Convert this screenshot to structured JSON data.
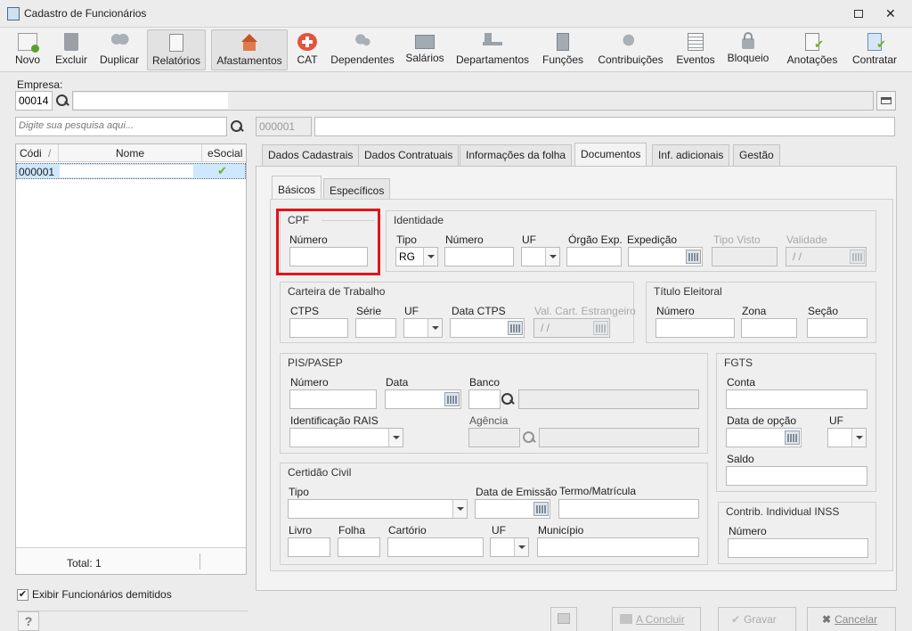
{
  "window": {
    "title": "Cadastro de Funcionários"
  },
  "toolbar": {
    "items": [
      "Novo",
      "Excluir",
      "Duplicar",
      "Relatórios",
      "Afastamentos",
      "CAT",
      "Dependentes",
      "Salários",
      "Departamentos",
      "Funções",
      "Contribuições",
      "Eventos",
      "Bloqueio",
      "Anotações",
      "Contratar"
    ]
  },
  "empresa": {
    "label": "Empresa:",
    "code": "00014"
  },
  "search": {
    "placeholder": "Digite sua pesquisa aqui...",
    "code_placeholder": "000001"
  },
  "grid": {
    "columns": [
      "Códi",
      "Nome",
      "eSocial"
    ],
    "rows": [
      {
        "code": "000001"
      }
    ],
    "total": "Total: 1"
  },
  "show_dismissed": "Exibir Funcionários demitidos",
  "tabs": [
    "Dados Cadastrais",
    "Dados Contratuais",
    "Informações da folha",
    "Documentos",
    "Inf. adicionais",
    "Gestão"
  ],
  "subtabs": [
    "Básicos",
    "Específicos"
  ],
  "cpf": {
    "title": "CPF",
    "numero": "Número"
  },
  "identidade": {
    "title": "Identidade",
    "tipo": "Tipo",
    "tipo_value": "RG",
    "numero": "Número",
    "uf": "UF",
    "orgao": "Órgão Exp.",
    "expedicao": "Expedição",
    "tipo_visto": "Tipo Visto",
    "validade": "Validade",
    "validade_value": "/ /"
  },
  "ctps": {
    "title": "Carteira de Trabalho",
    "ctps": "CTPS",
    "serie": "Série",
    "uf": "UF",
    "data": "Data CTPS",
    "val": "Val. Cart. Estrangeiro",
    "val_value": "/ /"
  },
  "titulo": {
    "title": "Título Eleitoral",
    "numero": "Número",
    "zona": "Zona",
    "secao": "Seção"
  },
  "pis": {
    "title": "PIS/PASEP",
    "numero": "Número",
    "data": "Data",
    "banco": "Banco",
    "rais": "Identificação RAIS",
    "agencia": "Agência"
  },
  "fgts": {
    "title": "FGTS",
    "conta": "Conta",
    "data_opcao": "Data de opção",
    "uf": "UF",
    "saldo": "Saldo"
  },
  "certidao": {
    "title": "Certidão Civil",
    "tipo": "Tipo",
    "emissao": "Data de Emissão",
    "termo": "Termo/Matrícula",
    "livro": "Livro",
    "folha": "Folha",
    "cartorio": "Cartório",
    "uf": "UF",
    "municipio": "Município"
  },
  "inss": {
    "title": "Contrib. Individual INSS",
    "numero": "Número"
  },
  "buttons": {
    "help": "?",
    "concluir": "A Concluir",
    "gravar": "Gravar",
    "cancelar": "Cancelar"
  },
  "colors": {
    "highlight": "#e0141b",
    "selection": "#cde8ff",
    "check": "#6ab31f"
  }
}
